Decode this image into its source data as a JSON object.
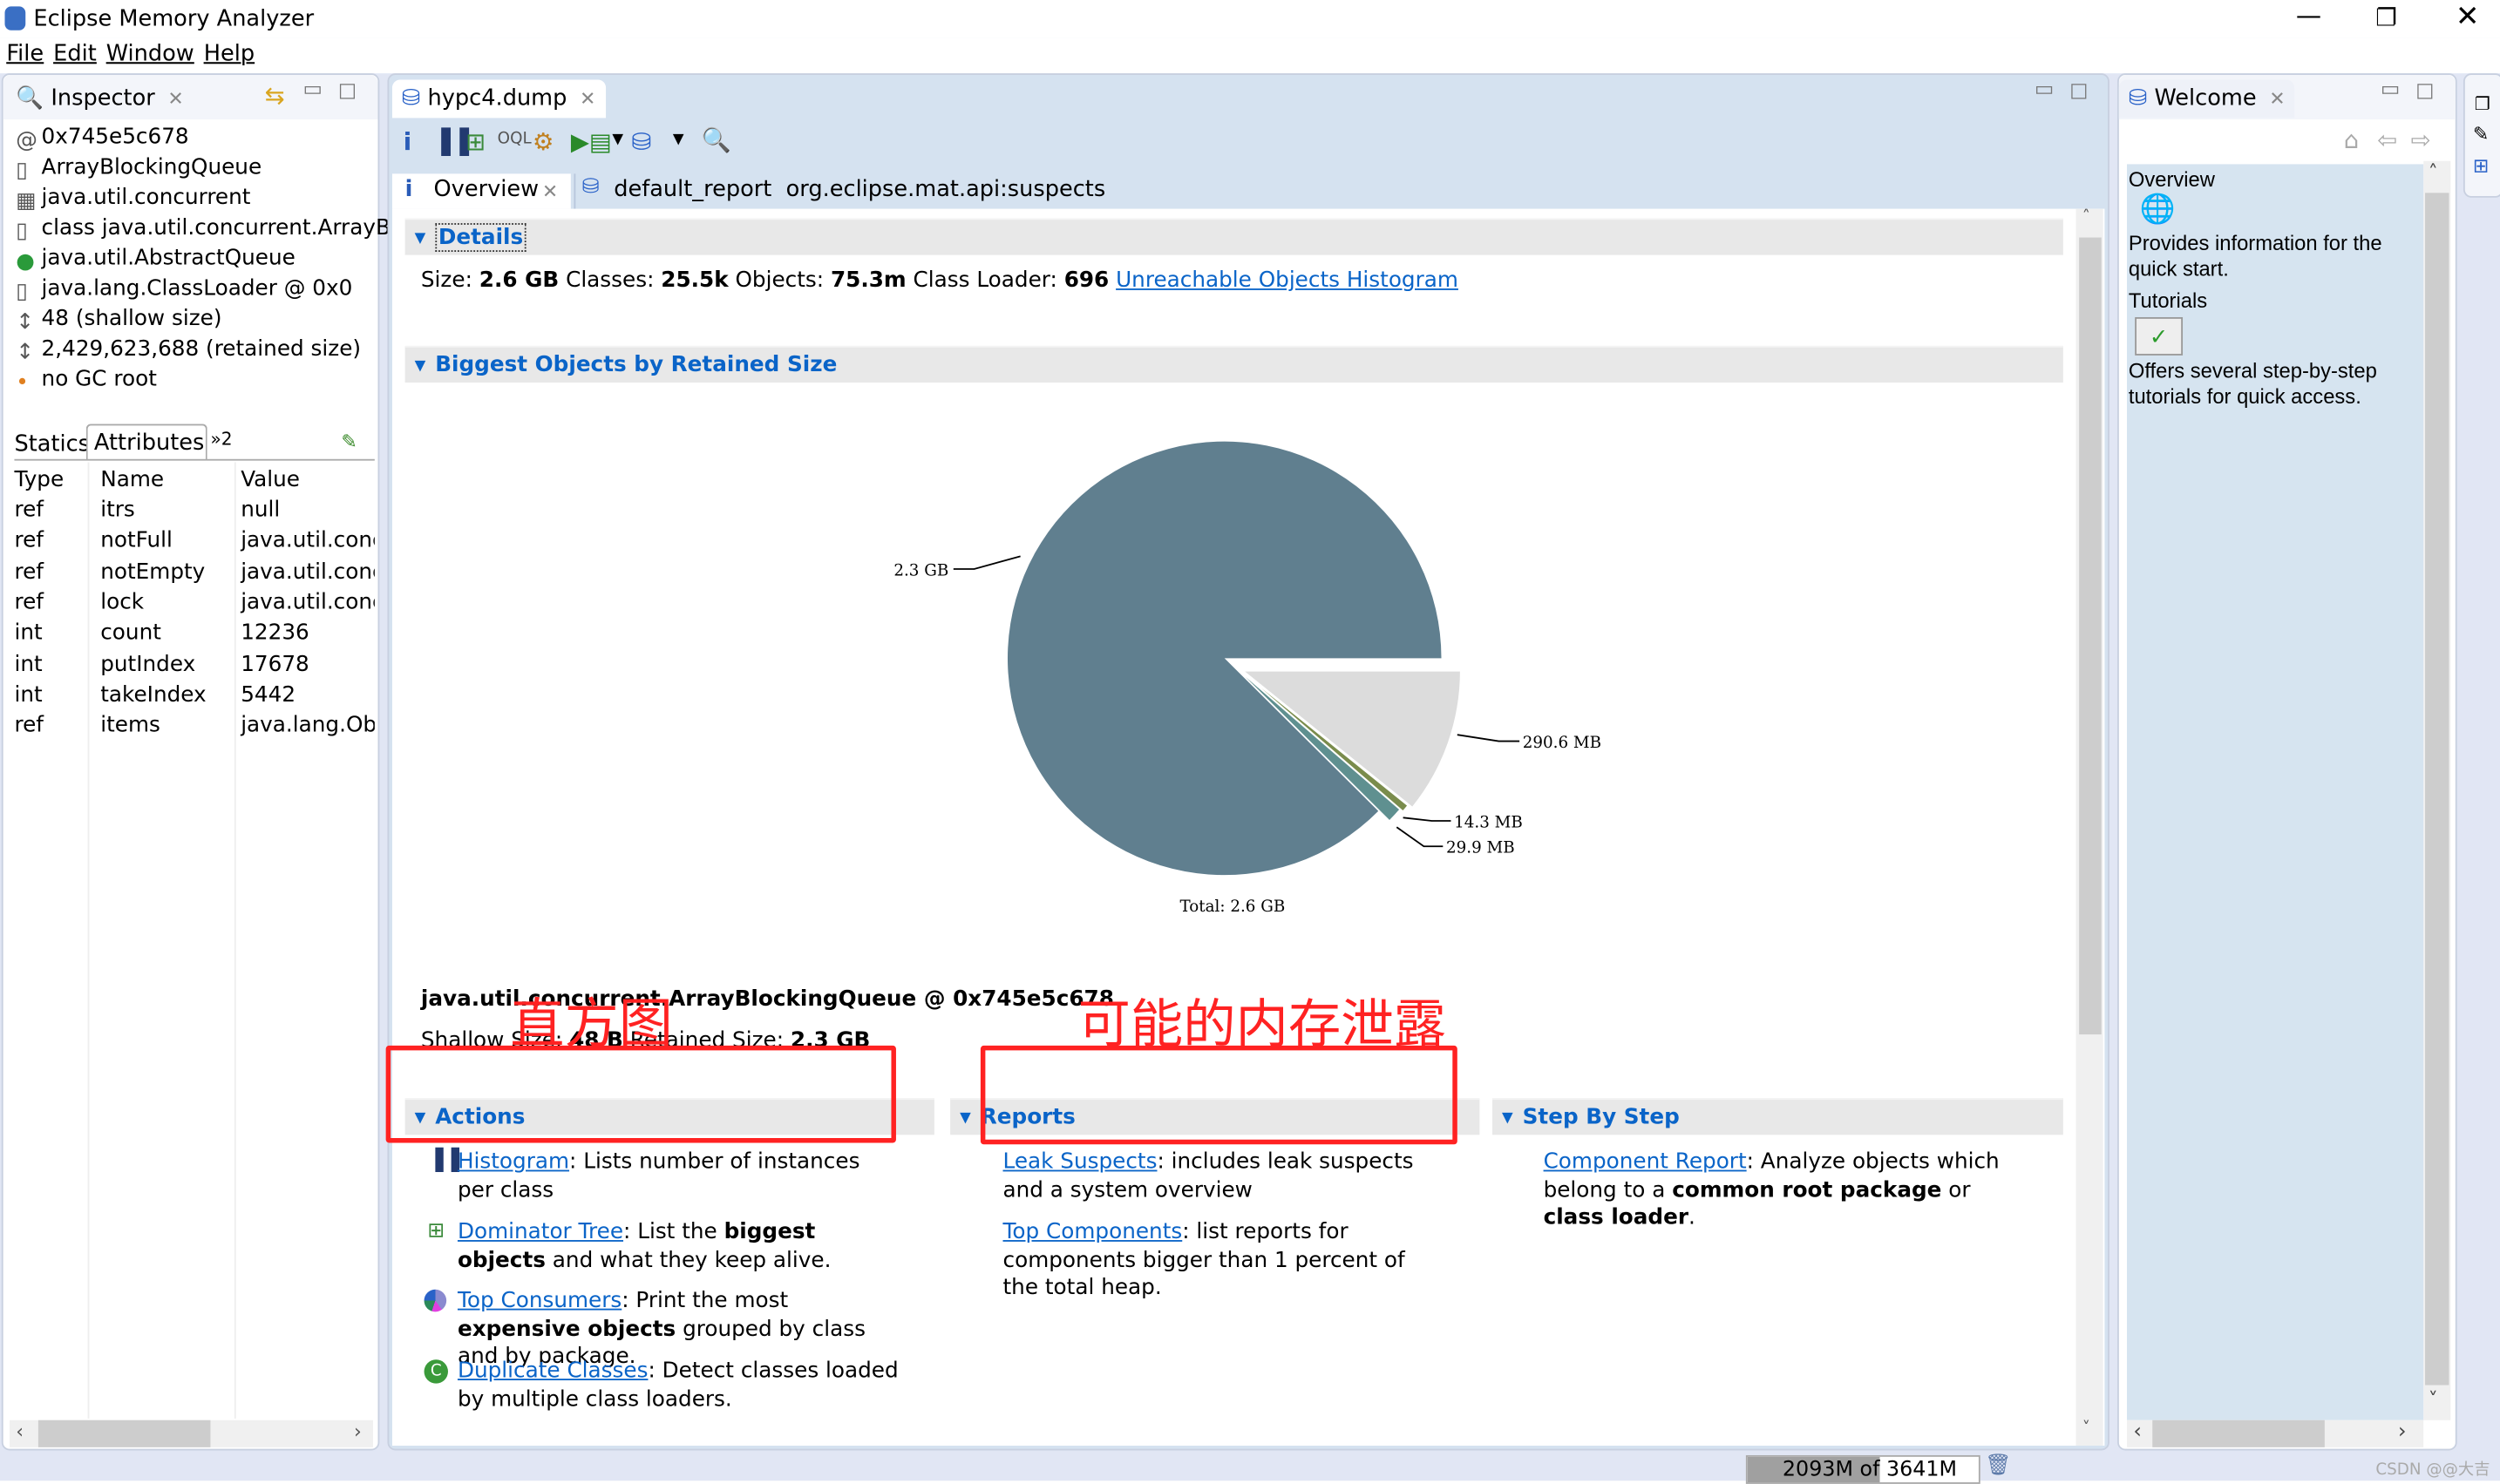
{
  "window": {
    "title": "Eclipse Memory Analyzer",
    "controls": [
      "minimize",
      "restore",
      "close"
    ]
  },
  "menu": [
    "File",
    "Edit",
    "Window",
    "Help"
  ],
  "inspector": {
    "tab": "Inspector",
    "items": [
      {
        "icon": "at-icon",
        "text": "0x745e5c678"
      },
      {
        "icon": "file-icon",
        "text": "ArrayBlockingQueue"
      },
      {
        "icon": "package-icon",
        "text": "java.util.concurrent"
      },
      {
        "icon": "class-icon",
        "text": "class java.util.concurrent.ArrayB..."
      },
      {
        "icon": "superclass-icon",
        "text": "java.util.AbstractQueue"
      },
      {
        "icon": "classloader-icon",
        "text": "java.lang.ClassLoader @ 0x0"
      },
      {
        "icon": "shallow-size-icon",
        "text": "48 (shallow size)"
      },
      {
        "icon": "retained-size-icon",
        "text": "2,429,623,688 (retained size)"
      },
      {
        "icon": "gc-root-icon",
        "text": "no GC root"
      }
    ],
    "subtabs": [
      "Statics",
      "Attributes"
    ],
    "overflow": "»2",
    "columns": [
      "Type",
      "Name",
      "Value"
    ],
    "rows": [
      [
        "ref",
        "itrs",
        "null"
      ],
      [
        "ref",
        "notFull",
        "java.util.concu"
      ],
      [
        "ref",
        "notEmpty",
        "java.util.concu"
      ],
      [
        "ref",
        "lock",
        "java.util.concu"
      ],
      [
        "int",
        "count",
        "12236"
      ],
      [
        "int",
        "putIndex",
        "17678"
      ],
      [
        "int",
        "takeIndex",
        "5442"
      ],
      [
        "ref",
        "items",
        "java.lang.Obje"
      ]
    ]
  },
  "editor": {
    "tab": "hypc4.dump",
    "subtabs": [
      "Overview",
      "default_report  org.eclipse.mat.api:suspects"
    ],
    "details": {
      "header": "Details",
      "size_label": "Size:",
      "size": "2.6 GB",
      "classes_label": "Classes:",
      "classes": "25.5k",
      "objects_label": "Objects:",
      "objects": "75.3m",
      "loader_label": "Class Loader:",
      "loader": "696",
      "link": "Unreachable Objects Histogram"
    },
    "biggest": {
      "header": "Biggest Objects by Retained Size",
      "object": "java.util.concurrent.ArrayBlockingQueue @ 0x745e5c678",
      "shallow_label": "Shallow Size:",
      "shallow": "48 B",
      "retained_label": "Retained Size:",
      "retained": "2.3 GB"
    },
    "actions": {
      "header": "Actions",
      "items": [
        {
          "link": "Histogram",
          "pre": ": Lists number of instances per class",
          "bold": "",
          "post": ""
        },
        {
          "link": "Dominator Tree",
          "pre": ": List the ",
          "bold": "biggest objects",
          "post": " and what they keep alive."
        },
        {
          "link": "Top Consumers",
          "pre": ": Print the most ",
          "bold": "expensive objects",
          "post": " grouped by class and by package."
        },
        {
          "link": "Duplicate Classes",
          "pre": ": Detect classes loaded by multiple class loaders.",
          "bold": "",
          "post": ""
        }
      ]
    },
    "reports": {
      "header": "Reports",
      "items": [
        {
          "link": "Leak Suspects",
          "text": ": includes leak suspects and a system overview"
        },
        {
          "link": "Top Components",
          "text": ": list reports for components bigger than 1 percent of the total heap."
        }
      ]
    },
    "step": {
      "header": "Step By Step",
      "link": "Component Report",
      "t1": ": Analyze objects which belong to a ",
      "b1": "common root package",
      "t2": " or ",
      "b2": "class loader",
      "t3": "."
    },
    "annotations": {
      "histogram": "直方图",
      "leak": "可能的内存泄露",
      "color": "#ff2222"
    }
  },
  "chart_data": {
    "type": "pie",
    "unit": "MB",
    "slices": [
      {
        "label": "290.6 MB",
        "value": 290.6,
        "color": "#dcdcdc",
        "exploded": true
      },
      {
        "label": "14.3 MB",
        "value": 14.3,
        "color": "#7a8c4c",
        "exploded": true
      },
      {
        "label": "29.9 MB",
        "value": 29.9,
        "color": "#5f9090",
        "exploded": true
      },
      {
        "label": "2.3 GB",
        "value": 2355,
        "color": "#607f8f",
        "exploded": false
      }
    ],
    "total_label": "Total: 2.6 GB"
  },
  "welcome": {
    "tab": "Welcome",
    "overview": "Overview",
    "overview_text": "Provides information for the quick start.",
    "tutorials": "Tutorials",
    "tutorials_text": "Offers several step-by-step tutorials for quick access."
  },
  "status": {
    "memory": "2093M of 3641M",
    "used_fraction": 0.575,
    "watermark": "CSDN @@大吉"
  }
}
